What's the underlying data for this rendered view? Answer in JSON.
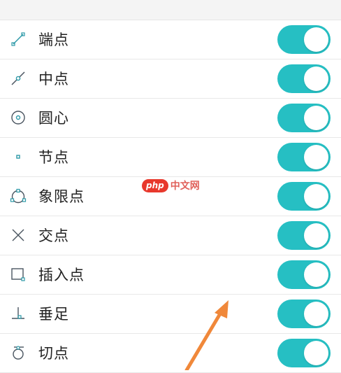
{
  "settings": [
    {
      "label": "端点",
      "icon": "endpoint-snap-icon",
      "enabled": true
    },
    {
      "label": "中点",
      "icon": "midpoint-snap-icon",
      "enabled": true
    },
    {
      "label": "圆心",
      "icon": "center-snap-icon",
      "enabled": true
    },
    {
      "label": "节点",
      "icon": "node-snap-icon",
      "enabled": true
    },
    {
      "label": "象限点",
      "icon": "quadrant-snap-icon",
      "enabled": true
    },
    {
      "label": "交点",
      "icon": "intersection-snap-icon",
      "enabled": true
    },
    {
      "label": "插入点",
      "icon": "insertion-snap-icon",
      "enabled": true
    },
    {
      "label": "垂足",
      "icon": "perpendicular-snap-icon",
      "enabled": true
    },
    {
      "label": "切点",
      "icon": "tangent-snap-icon",
      "enabled": true
    }
  ],
  "watermark": {
    "badge": "php",
    "text": "中文网"
  },
  "colors": {
    "toggle_on": "#26bfc3",
    "icon": "#2d9aa8",
    "arrow": "#f0883a",
    "watermark": "#e8382c"
  }
}
